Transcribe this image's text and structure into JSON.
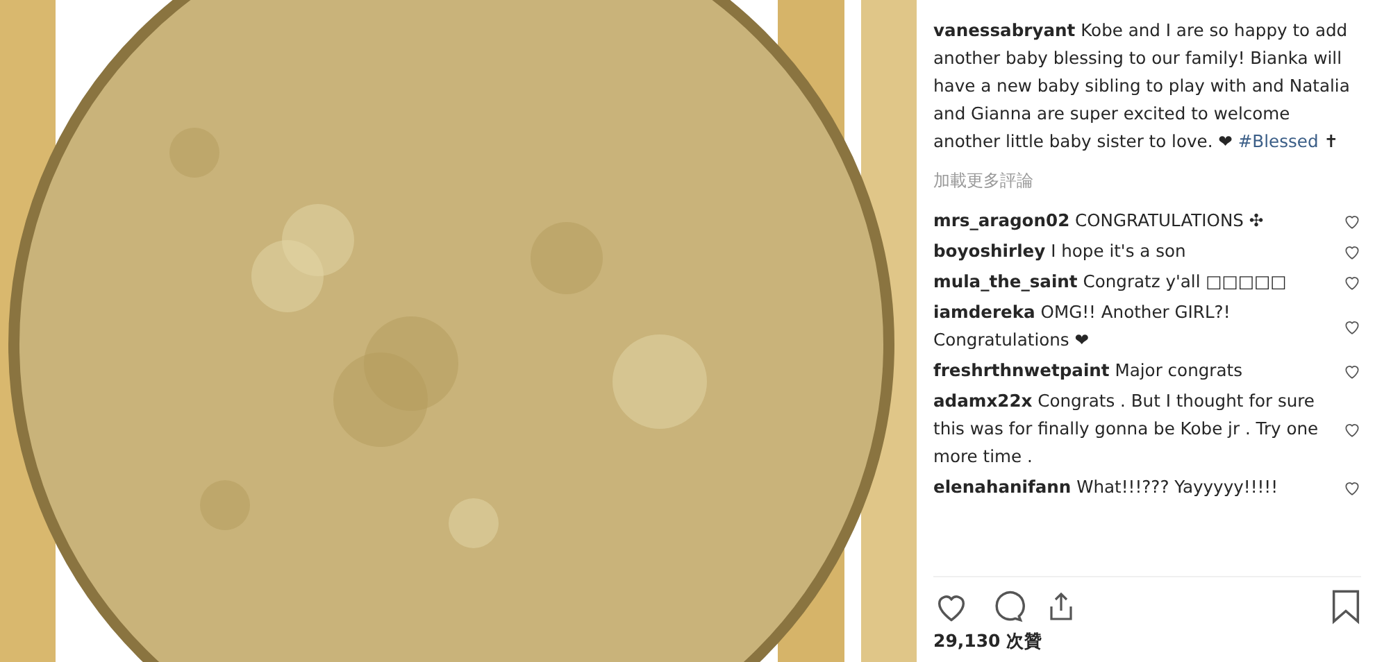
{
  "caption": {
    "username": "vanessabryant",
    "text": "Kobe and I are so happy to add another baby blessing to our family! Bianka will have a new baby sibling to play with and Natalia and Gianna are super excited to welcome another little baby sister to love. ❤",
    "hashtag": "#Blessed",
    "trailing": "✝"
  },
  "load_more": "加載更多評論",
  "comments": [
    {
      "username": "mrs_aragon02",
      "text": "CONGRATULATIONS ✣",
      "liked": false
    },
    {
      "username": "boyoshirley",
      "text": "I hope it's a son",
      "liked": false
    },
    {
      "username": "mula_the_saint",
      "text": "Congratz y'all □□□□□",
      "liked": false
    },
    {
      "username": "iamdereka",
      "text": "OMG!! Another GIRL?! Congratulations ❤",
      "liked": false
    },
    {
      "username": "freshrthnwetpaint",
      "text": "Major congrats",
      "liked": false
    },
    {
      "username": "adamx22x",
      "text": "Congrats . But I thought for sure this was for finally gonna be Kobe jr . Try one more time .",
      "liked": false
    },
    {
      "username": "elenahanifann",
      "text": "What!!!??? Yayyyyy!!!!!",
      "liked": false
    }
  ],
  "liked": false,
  "saved": false,
  "likes": "29,130 次贊"
}
